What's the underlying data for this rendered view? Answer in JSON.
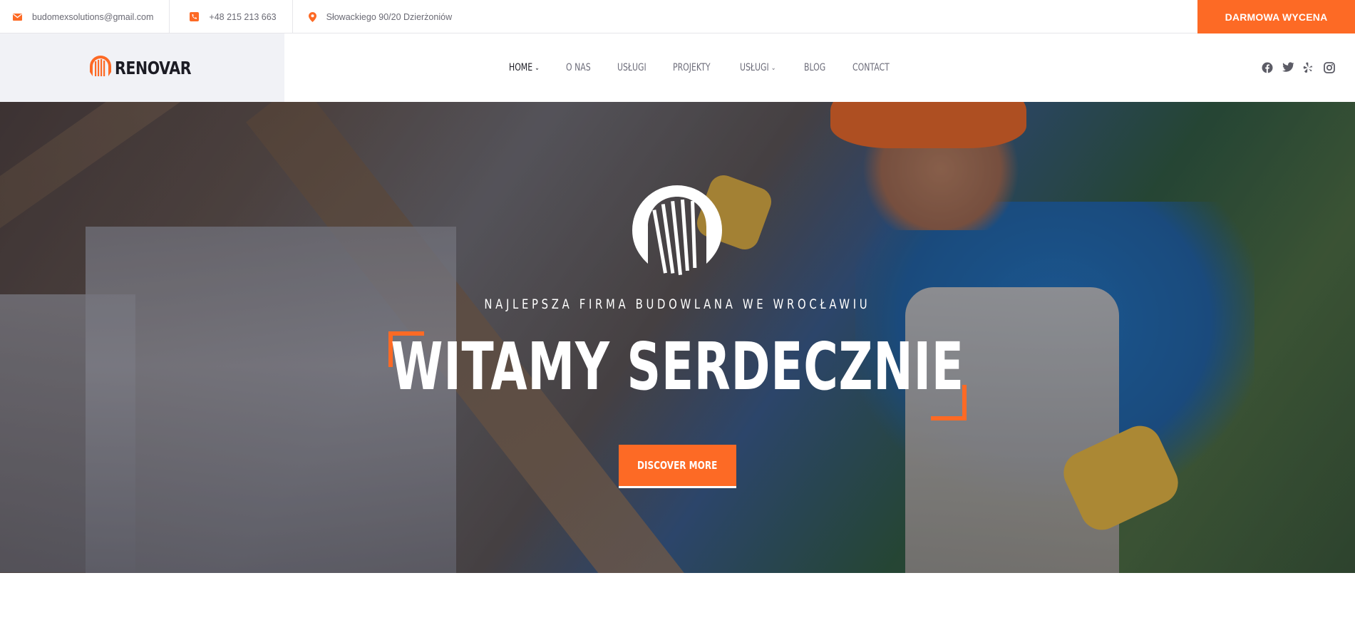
{
  "topbar": {
    "email": "budomexsolutions@gmail.com",
    "phone": "+48 215 213 663",
    "address": "Słowackiego 90/20 Dzierżoniów",
    "cta_label": "DARMOWA WYCENA",
    "icons": [
      "envelope-icon",
      "phone-icon",
      "map-pin-icon"
    ],
    "accent": "#fd6a25"
  },
  "header": {
    "logo_text": "RENOVAR",
    "nav": [
      {
        "label": "HOME",
        "dropdown": true,
        "active": true
      },
      {
        "label": "O NAS",
        "dropdown": false
      },
      {
        "label": "USŁUGI",
        "dropdown": false
      },
      {
        "label": "PROJEKTY",
        "dropdown": false
      },
      {
        "label": "USŁUGI",
        "dropdown": true
      },
      {
        "label": "BLOG",
        "dropdown": false
      },
      {
        "label": "CONTACT",
        "dropdown": false
      }
    ],
    "social": [
      "facebook-icon",
      "twitter-icon",
      "yelp-icon",
      "instagram-icon"
    ]
  },
  "hero": {
    "subtitle": "NAJLEPSZA FIRMA BUDOWLANA WE WROCŁAWIU",
    "title": "WITAMY SERDECZNIE",
    "button_label": "DISCOVER MORE"
  }
}
